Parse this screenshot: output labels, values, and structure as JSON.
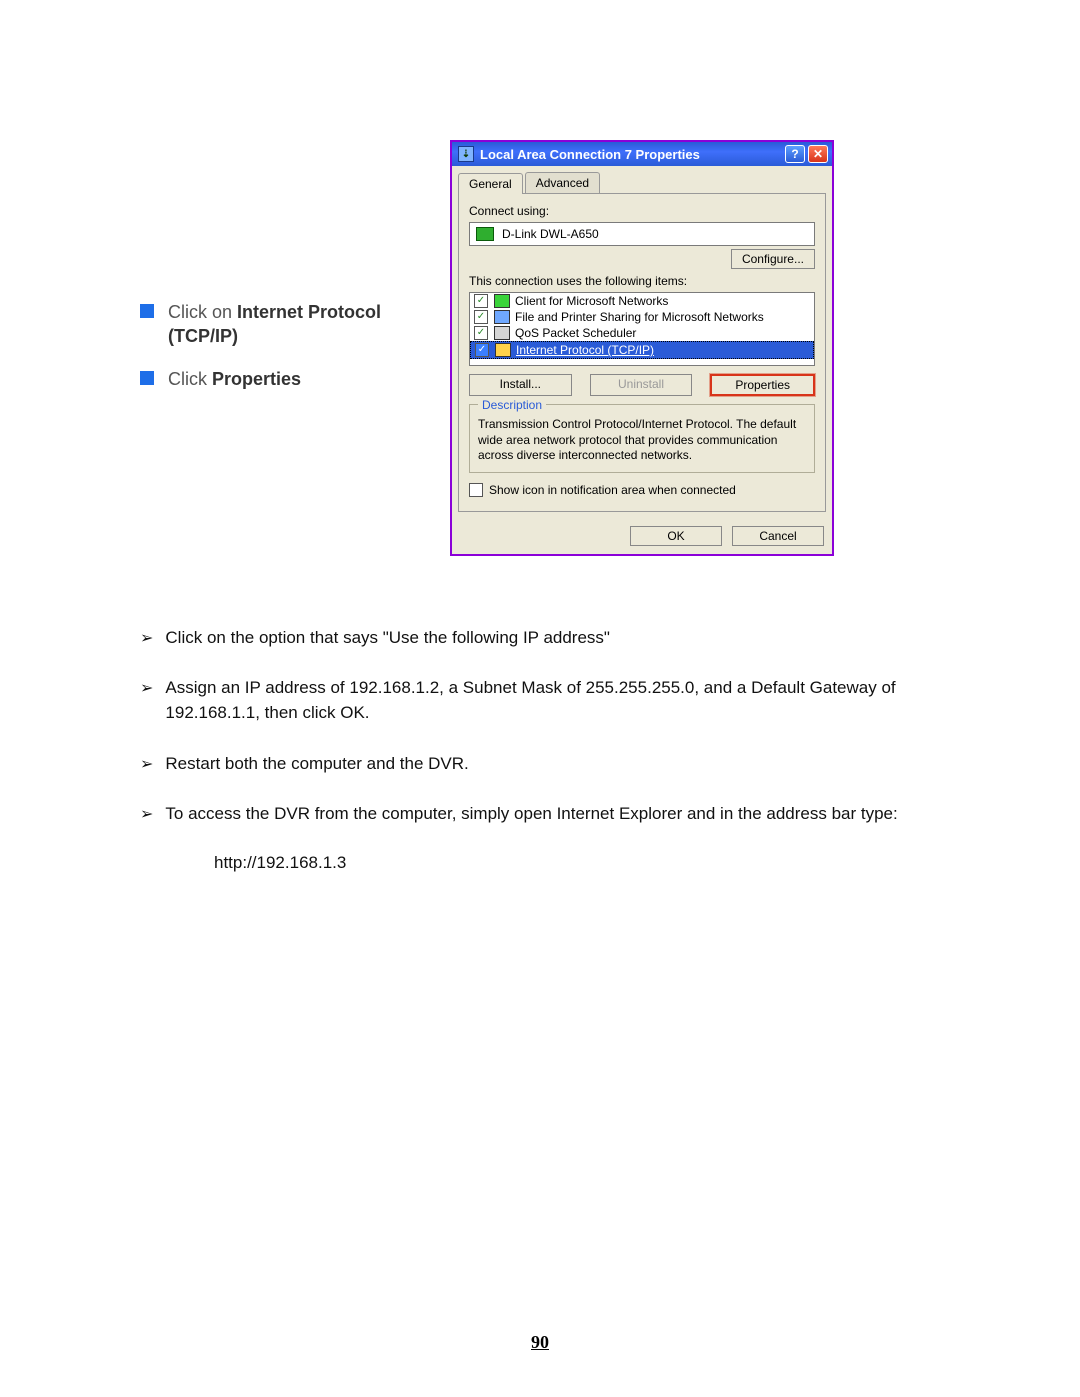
{
  "instructions": {
    "line1_prefix": "Click on ",
    "line1_bold": "Internet Protocol (TCP/IP)",
    "line2_prefix": "Click ",
    "line2_bold": "Properties"
  },
  "dialog": {
    "title": "Local Area Connection 7 Properties",
    "tabs": {
      "general": "General",
      "advanced": "Advanced"
    },
    "connect_using_label": "Connect using:",
    "adapter": "D-Link DWL-A650",
    "configure_btn": "Configure...",
    "uses_label": "This connection uses the following items:",
    "items": [
      "Client for Microsoft Networks",
      "File and Printer Sharing for Microsoft Networks",
      "QoS Packet Scheduler",
      "Internet Protocol (TCP/IP)"
    ],
    "install_btn": "Install...",
    "uninstall_btn": "Uninstall",
    "properties_btn": "Properties",
    "description_label": "Description",
    "description_text": "Transmission Control Protocol/Internet Protocol. The default wide area network protocol that provides communication across diverse interconnected networks.",
    "show_icon_label": "Show icon in notification area when connected",
    "ok_btn": "OK",
    "cancel_btn": "Cancel"
  },
  "steps": {
    "s1": "Click on the option that says \"Use the following IP address\"",
    "s2": "Assign an IP address of 192.168.1.2, a Subnet Mask of 255.255.255.0, and a Default Gateway of 192.168.1.1, then click OK.",
    "s3": "Restart both the computer and the DVR.",
    "s4": "To access the DVR from the computer, simply open Internet Explorer and in the address bar type:",
    "address": "http://192.168.1.3"
  },
  "page_number": "90"
}
